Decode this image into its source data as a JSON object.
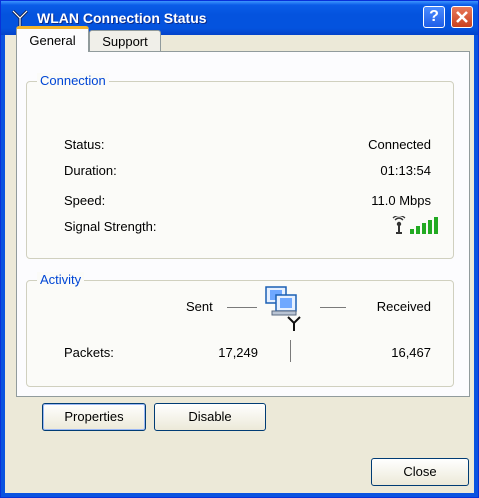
{
  "window": {
    "title": "WLAN Connection Status",
    "help_glyph": "?"
  },
  "tabs": [
    {
      "label": "General",
      "active": true
    },
    {
      "label": "Support",
      "active": false
    }
  ],
  "connection": {
    "group_label": "Connection",
    "rows": [
      {
        "label": "Status:",
        "value": "Connected"
      },
      {
        "label": "Duration:",
        "value": "01:13:54"
      },
      {
        "label": "Speed:",
        "value": "11.0 Mbps"
      },
      {
        "label": "Signal Strength:",
        "icon": "signal-strength-icon",
        "bars_lit": 5,
        "bars_total": 5
      }
    ]
  },
  "activity": {
    "group_label": "Activity",
    "sent_label": "Sent",
    "received_label": "Received",
    "packets_label": "Packets:",
    "packets_sent": "17,249",
    "packets_received": "16,467",
    "icon": "network-computers-icon"
  },
  "buttons": {
    "properties": "Properties",
    "disable": "Disable",
    "close": "Close"
  },
  "colors": {
    "titlebar": "#0453de",
    "accent_tab": "#f3b52c",
    "group_title": "#0046d5",
    "signal": "#22aa22"
  }
}
